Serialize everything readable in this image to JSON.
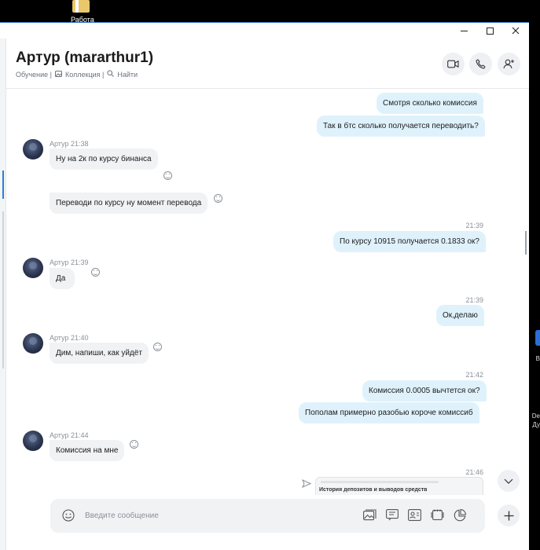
{
  "desktop": {
    "folder_label": "Работа",
    "side_text_1": "В",
    "side_text_2a": "De",
    "side_text_2b": "Ду"
  },
  "window": {
    "controls": [
      "minimize",
      "maximize",
      "close"
    ]
  },
  "header": {
    "title": "Артур (mararthur1)",
    "links": [
      "Обучение |",
      "Коллекция |",
      "Найти"
    ]
  },
  "messages": [
    {
      "dir": "out",
      "text": "Смотря сколько комиссия"
    },
    {
      "dir": "out",
      "text": "Так в бтс сколько получается переводить?"
    },
    {
      "dir": "in",
      "meta": "Артур 21:38",
      "text": "Ну на 2к по курсу бинанса"
    },
    {
      "dir": "in",
      "text": "Переводи по курсу ну момент перевода"
    },
    {
      "dir": "out",
      "time": "21:39",
      "text": "По курсу 10915 получается 0.1833 ок?"
    },
    {
      "dir": "in",
      "meta": "Артур 21:39",
      "text": "Да"
    },
    {
      "dir": "out",
      "time": "21:39",
      "text": "Ок,делаю"
    },
    {
      "dir": "in",
      "meta": "Артур 21:40",
      "text": "Дим, напиши, как уйдёт"
    },
    {
      "dir": "out",
      "time": "21:42",
      "text": "Комиссия 0.0005 вычтется ок?"
    },
    {
      "dir": "out",
      "text": "Пополам примерно разобью короче комиссиб"
    },
    {
      "dir": "in",
      "meta": "Артур 21:44",
      "text": "Комиссия на мне"
    },
    {
      "dir": "out",
      "time": "21:46",
      "attachment_title": "История депозитов и выводов средств"
    }
  ],
  "composer": {
    "placeholder": "Введите сообщение"
  },
  "icons": {
    "video": "video-call-icon",
    "call": "phone-icon",
    "add": "add-person-icon",
    "emoji": "emoji-icon",
    "gallery": "gallery-icon",
    "contact": "contact-card-icon",
    "gif": "gif-icon",
    "poll": "poll-icon",
    "mention": "mention-icon",
    "plus": "plus-icon",
    "down": "chevron-down-icon"
  },
  "colors": {
    "outgoing_bubble": "#dff2fc",
    "incoming_bubble": "#f1f2f4",
    "accent": "#2a7fd6"
  }
}
